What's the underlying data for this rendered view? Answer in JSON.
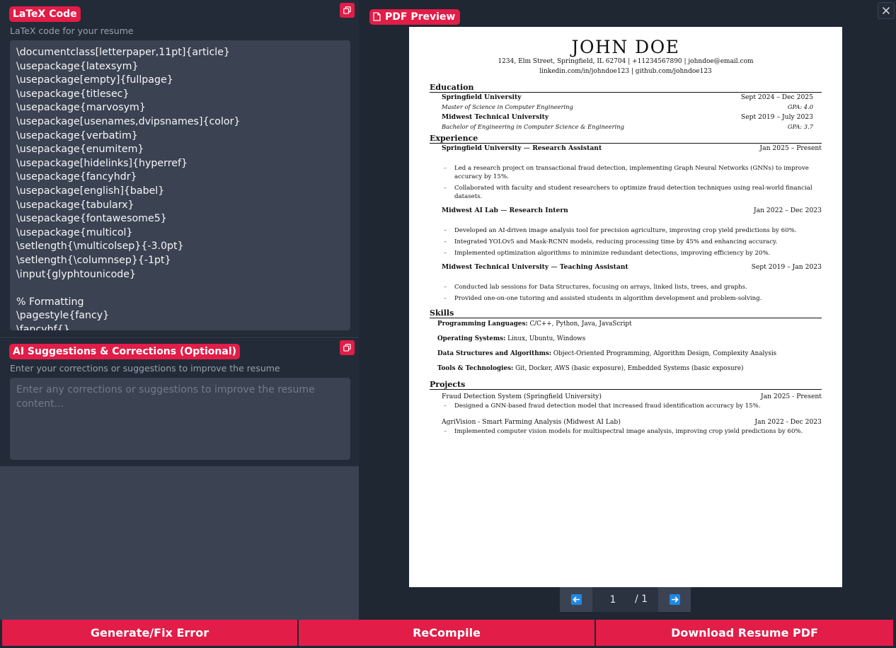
{
  "latex_panel": {
    "title": "LaTeX Code",
    "subtitle": "LaTeX code for your resume",
    "code_lines": [
      "\\documentclass[letterpaper,11pt]{article}",
      "\\usepackage{latexsym}",
      "\\usepackage[empty]{fullpage}",
      "\\usepackage{titlesec}",
      "\\usepackage{marvosym}",
      "\\usepackage[usenames,dvipsnames]{color}",
      "\\usepackage{verbatim}",
      "\\usepackage{enumitem}",
      "\\usepackage[hidelinks]{hyperref}",
      "\\usepackage{fancyhdr}",
      "\\usepackage[english]{babel}",
      "\\usepackage{tabularx}",
      "\\usepackage{fontawesome5}",
      "\\usepackage{multicol}",
      "\\setlength{\\multicolsep}{-3.0pt}",
      "\\setlength{\\columnsep}{-1pt}",
      "\\input{glyphtounicode}",
      "",
      "% Formatting",
      "\\pagestyle{fancy}",
      "\\fancyhf{}"
    ],
    "copy_icon": "copy-icon"
  },
  "ai_panel": {
    "title": "AI Suggestions & Corrections (Optional)",
    "subtitle": "Enter your corrections or suggestions to improve the resume",
    "placeholder": "Enter any corrections or suggestions to improve the resume content...",
    "value": "",
    "copy_icon": "copy-icon"
  },
  "preview": {
    "title": "PDF Preview",
    "icon": "pdf-file-icon",
    "close_icon": "close-icon",
    "resume": {
      "name": "JOHN DOE",
      "contact_line1": "1234, Elm Street, Springfield, IL 62704 | +11234567890 | johndoe@email.com",
      "contact_line2": "linkedin.com/in/johndoe123 | github.com/johndoe123",
      "education_heading": "Education",
      "education": [
        {
          "school": "Springfield University",
          "dates": "Sept 2024 – Dec 2025",
          "degree": "Master of Science in Computer Engineering",
          "gpa": "GPA: 4.0"
        },
        {
          "school": "Midwest Technical University",
          "dates": "Sept 2019 – July 2023",
          "degree": "Bachelor of Engineering in Computer Science & Engineering",
          "gpa": "GPA: 3.7"
        }
      ],
      "experience_heading": "Experience",
      "experience": [
        {
          "org": "Springfield University",
          "role": "Research Assistant",
          "dates": "Jan 2025 – Present",
          "bullets": [
            "Led a research project on transactional fraud detection, implementing Graph Neural Networks (GNNs) to improve accuracy by 15%.",
            "Collaborated with faculty and student researchers to optimize fraud detection techniques using real-world financial datasets."
          ]
        },
        {
          "org": "Midwest AI Lab",
          "role": "Research Intern",
          "dates": "Jan 2022 – Dec 2023",
          "bullets": [
            "Developed an AI-driven image analysis tool for precision agriculture, improving crop yield predictions by 60%.",
            "Integrated YOLOv5 and Mask-RCNN models, reducing processing time by 45% and enhancing accuracy.",
            "Implemented optimization algorithms to minimize redundant detections, improving efficiency by 20%."
          ]
        },
        {
          "org": "Midwest Technical University",
          "role": "Teaching Assistant",
          "dates": "Sept 2019 – Jan 2023",
          "bullets": [
            "Conducted lab sessions for Data Structures, focusing on arrays, linked lists, trees, and graphs.",
            "Provided one-on-one tutoring and assisted students in algorithm development and problem-solving."
          ]
        }
      ],
      "role_separator": "—",
      "skills_heading": "Skills",
      "skills": [
        {
          "label": "Programming Languages:",
          "value": "C/C++, Python, Java, JavaScript"
        },
        {
          "label": "Operating Systems:",
          "value": "Linux, Ubuntu, Windows"
        },
        {
          "label": "Data Structures and Algorithms:",
          "value": "Object-Oriented Programming, Algorithm Design, Complexity Analysis"
        },
        {
          "label": "Tools & Technologies:",
          "value": "Git, Docker, AWS (basic exposure), Embedded Systems (basic exposure)"
        }
      ],
      "projects_heading": "Projects",
      "projects": [
        {
          "name": "Fraud Detection System (Springfield University)",
          "dates": "Jan 2025 - Present",
          "bullet": "Designed a GNN-based fraud detection model that increased fraud identification accuracy by 15%."
        },
        {
          "name": "AgriVision - Smart Farming Analysis (Midwest AI Lab)",
          "dates": "Jan 2022 - Dec 2023",
          "bullet": "Implemented computer vision models for multispectral image analysis, improving crop yield predictions by 60%."
        }
      ]
    },
    "pager": {
      "current": "1",
      "total": "/ 1",
      "prev_icon": "arrow-left-icon",
      "next_icon": "arrow-right-icon"
    }
  },
  "actions": {
    "generate": "Generate/Fix Error",
    "recompile": "ReCompile",
    "download": "Download Resume PDF"
  },
  "colors": {
    "accent": "#e11d48",
    "panel": "#232b38",
    "field": "#3b4352",
    "background": "#1f2733",
    "pager_arrow": "#1e88e5"
  }
}
